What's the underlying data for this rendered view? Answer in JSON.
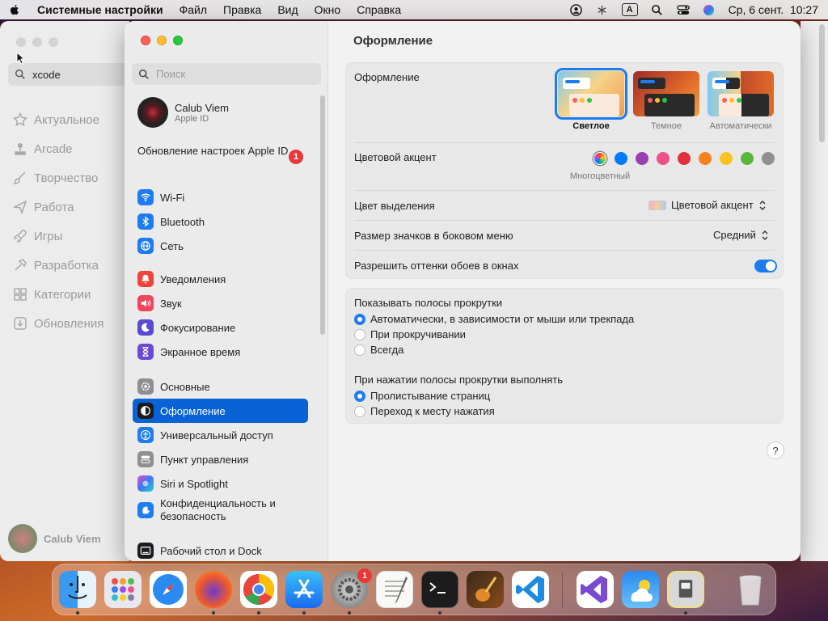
{
  "menubar": {
    "app_name": "Системные настройки",
    "items": [
      "Файл",
      "Правка",
      "Вид",
      "Окно",
      "Справка"
    ],
    "keyboard_indicator": "A",
    "clock": "Ср, 6 сент.  10:27"
  },
  "background_app": {
    "search_value": "xcode",
    "nav": [
      {
        "label": "Актуальное",
        "icon": "star-icon"
      },
      {
        "label": "Arcade",
        "icon": "joystick-icon"
      },
      {
        "label": "Творчество",
        "icon": "brush-icon"
      },
      {
        "label": "Работа",
        "icon": "paperplane-icon"
      },
      {
        "label": "Игры",
        "icon": "rocket-icon"
      },
      {
        "label": "Разработка",
        "icon": "hammer-icon"
      },
      {
        "label": "Категории",
        "icon": "grid-icon"
      },
      {
        "label": "Обновления",
        "icon": "download-icon"
      }
    ],
    "user_name": "Calub Viem"
  },
  "sidebar": {
    "search_placeholder": "Поиск",
    "profile": {
      "name": "Calub Viem",
      "sub": "Apple ID"
    },
    "update": {
      "label": "Обновление настроек Apple ID",
      "badge": "1"
    },
    "groups": [
      [
        {
          "label": "Wi-Fi",
          "icon": "wifi-icon",
          "color": "#1f7cf0"
        },
        {
          "label": "Bluetooth",
          "icon": "bluetooth-icon",
          "color": "#1f7cf0"
        },
        {
          "label": "Сеть",
          "icon": "globe-icon",
          "color": "#1f7cf0"
        }
      ],
      [
        {
          "label": "Уведомления",
          "icon": "bell-icon",
          "color": "#f0443a"
        },
        {
          "label": "Звук",
          "icon": "speaker-icon",
          "color": "#f0445a"
        },
        {
          "label": "Фокусирование",
          "icon": "moon-icon",
          "color": "#5a4ad0"
        },
        {
          "label": "Экранное время",
          "icon": "hourglass-icon",
          "color": "#6a4ad0"
        }
      ],
      [
        {
          "label": "Основные",
          "icon": "gear-icon",
          "color": "#8e8e93"
        },
        {
          "label": "Оформление",
          "icon": "appearance-icon",
          "color": "#1c1c1e",
          "active": true
        },
        {
          "label": "Универсальный доступ",
          "icon": "accessibility-icon",
          "color": "#1f7cf0"
        },
        {
          "label": "Пункт управления",
          "icon": "control-center-icon",
          "color": "#8e8e93"
        },
        {
          "label": "Siri и Spotlight",
          "icon": "siri-icon",
          "color": "#3a3a8a"
        },
        {
          "label": "Конфиденциальность и безопасность",
          "icon": "hand-icon",
          "color": "#1f7cf0"
        }
      ],
      [
        {
          "label": "Рабочий стол и Dock",
          "icon": "dock-icon",
          "color": "#1c1c1e"
        }
      ]
    ]
  },
  "content": {
    "title": "Оформление",
    "appearance": {
      "label": "Оформление",
      "options": [
        "Светлое",
        "Темное",
        "Автоматически"
      ],
      "selected": "Светлое"
    },
    "accent": {
      "label": "Цветовой акцент",
      "selected_caption": "Многоцветный",
      "colors": [
        "#007aff",
        "#9a3fb0",
        "#f0508a",
        "#e0303a",
        "#f5821f",
        "#f8c320",
        "#5ab53a",
        "#8e8e93"
      ]
    },
    "highlight": {
      "label": "Цвет выделения",
      "value": "Цветовой акцент"
    },
    "sidebar_icon_size": {
      "label": "Размер значков в боковом меню",
      "value": "Средний"
    },
    "wallpaper_tint": {
      "label": "Разрешить оттенки обоев в окнах",
      "on": true
    },
    "scrollbars": {
      "label": "Показывать полосы прокрутки",
      "options": [
        "Автоматически, в зависимости от мыши или трекпада",
        "При прокручивании",
        "Всегда"
      ],
      "selected_index": 0
    },
    "scroll_click": {
      "label": "При нажатии полосы прокрутки выполнять",
      "options": [
        "Пролистывание страниц",
        "Переход к месту нажатия"
      ],
      "selected_index": 0
    },
    "help": "?"
  },
  "dock": {
    "apps": [
      "Finder",
      "Launchpad",
      "Safari",
      "Firefox",
      "Chrome",
      "App Store",
      "Системные настройки",
      "TextEdit",
      "Терминал",
      "GarageBand",
      "Visual Studio Code",
      "Visual Studio",
      "Погода",
      "Preview",
      "Корзина"
    ],
    "settings_badge": "1"
  }
}
